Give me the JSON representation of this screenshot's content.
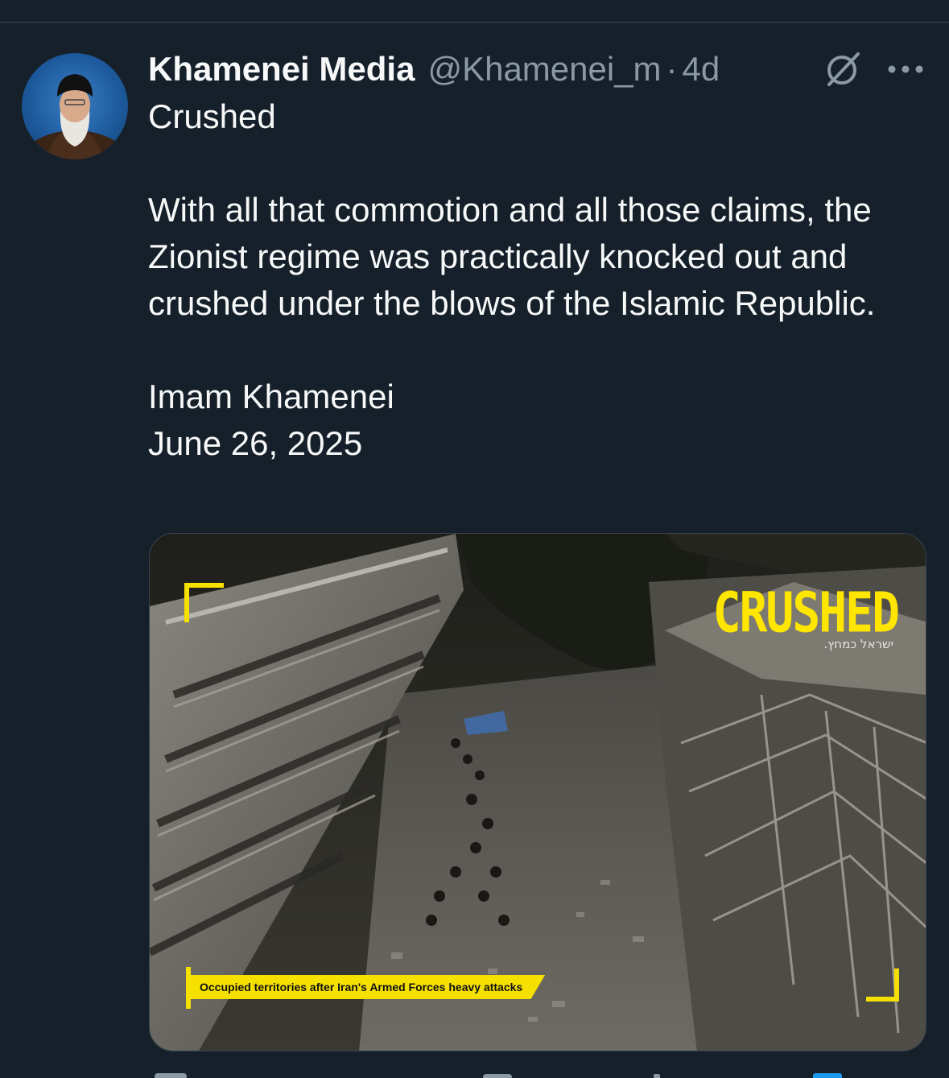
{
  "tweet": {
    "display_name": "Khamenei Media",
    "handle": "@Khamenei_m",
    "separator": "·",
    "time": "4d",
    "paragraphs": [
      "Crushed",
      "With all that commotion and all those claims, the Zionist regime was practically knocked out and crushed under the blows of the Islamic Republic.",
      "Imam Khamenei\nJune 26, 2025"
    ]
  },
  "media": {
    "title": "CRUSHED",
    "subtitle": "ישראל כמחץ.",
    "caption": "Occupied territories after Iran's Armed Forces heavy attacks"
  },
  "icons": {
    "grok": "grok-icon",
    "more": "more-options-icon",
    "avatar": "avatar"
  },
  "colors": {
    "background": "#15202b",
    "text": "#f7f9f9",
    "muted": "#8b98a5",
    "accent_yellow": "#ffe600"
  }
}
